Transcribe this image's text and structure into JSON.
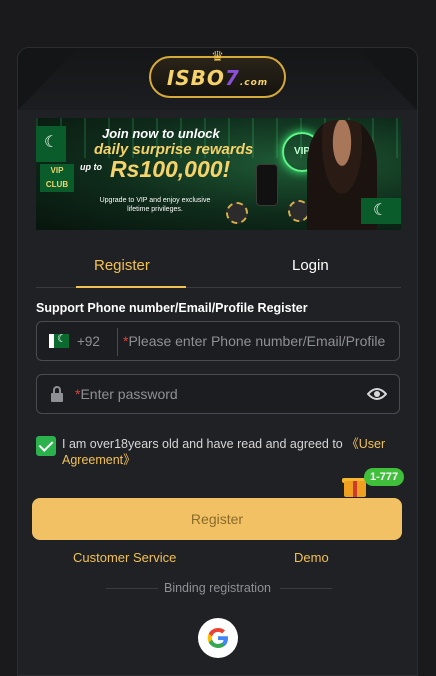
{
  "logo": {
    "text_main": "ISBO",
    "text_seven": "7",
    "text_com": ".com"
  },
  "banner": {
    "line1": "Join now to unlock",
    "line2": "daily surprise rewards",
    "upto": "up to",
    "amount": "Rs100,000!",
    "small": "Upgrade to VIP and enjoy exclusive lifetime privileges.",
    "vip_club": "VIP CLUB",
    "vip_coin": "VIP"
  },
  "tabs": {
    "register": "Register",
    "login": "Login"
  },
  "form": {
    "section_label": "Support Phone number/Email/Profile Register",
    "dial_code": "+92",
    "phone_placeholder": "Please enter Phone number/Email/Profile",
    "password_placeholder": "Enter password",
    "required_mark": "*"
  },
  "agreement": {
    "text": "I am over18years old and have read and agreed to ",
    "link": "《User Agreement》",
    "checked": true
  },
  "promo_badge": "1-777",
  "register_button": "Register",
  "links": {
    "customer_service": "Customer Service",
    "demo": "Demo"
  },
  "binding_label": "Binding registration",
  "colors": {
    "accent": "#f2c154",
    "button": "#f2c164",
    "check": "#2bb24c",
    "badge": "#3fbf3a"
  }
}
